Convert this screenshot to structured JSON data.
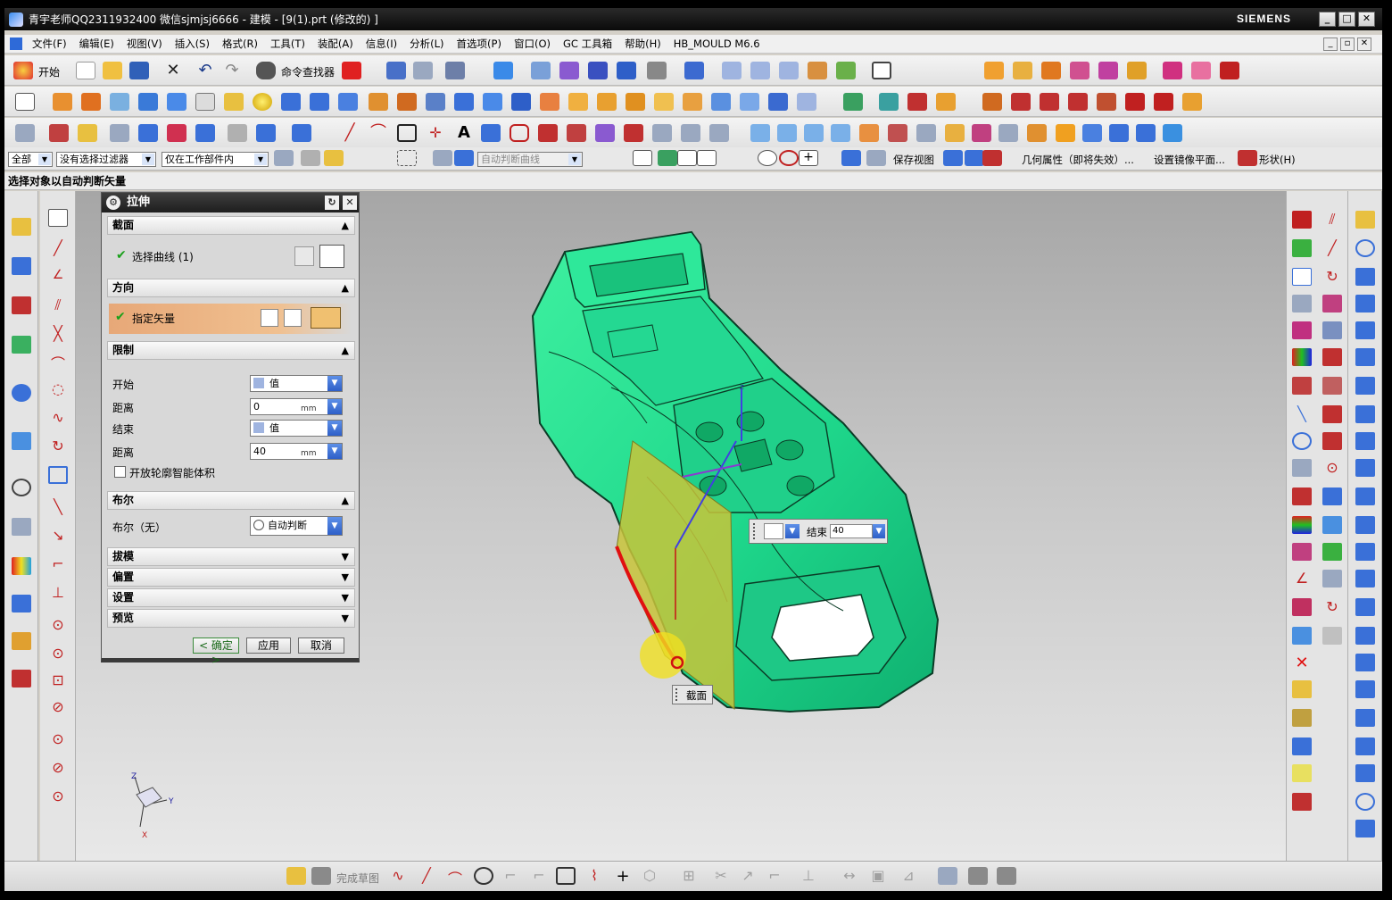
{
  "window": {
    "title": "青宇老师QQ2311932400 微信sjmjsj6666 - 建模 - [9(1).prt  (修改的) ]",
    "brand": "SIEMENS",
    "minimize": "_",
    "maximize": "□",
    "close": "✕"
  },
  "menu": {
    "items": [
      "文件(F)",
      "编辑(E)",
      "视图(V)",
      "插入(S)",
      "格式(R)",
      "工具(T)",
      "装配(A)",
      "信息(I)",
      "分析(L)",
      "首选项(P)",
      "窗口(O)",
      "GC 工具箱",
      "帮助(H)",
      "HB_MOULD M6.6"
    ]
  },
  "toolbar": {
    "start_label": "开始",
    "command_finder_label": "命令查找器"
  },
  "selection_bar": {
    "type_filter": "全部",
    "selection_filter": "没有选择过滤器",
    "scope": "仅在工作部件内",
    "curve_rule": "自动判断曲线",
    "save_view": "保存视图",
    "geometry_props": "几何属性（即将失效）...",
    "mirror_plane": "设置镜像平面...",
    "shape": "形状(H)"
  },
  "cue_line": "选择对象以自动判断矢量",
  "dialog": {
    "title": "拉伸",
    "section": {
      "header": "截面",
      "select_curve": "选择曲线 (1)"
    },
    "direction": {
      "header": "方向",
      "specify_vector": "指定矢量"
    },
    "limits": {
      "header": "限制",
      "start_label": "开始",
      "start_value": "值",
      "start_distance_label": "距离",
      "start_distance": "0",
      "end_label": "结束",
      "end_value": "值",
      "end_distance_label": "距离",
      "end_distance": "40",
      "unit": "mm",
      "open_profile": "开放轮廓智能体积"
    },
    "boolean": {
      "header": "布尔",
      "label": "布尔（无）",
      "value": "自动判断"
    },
    "collapsed": [
      "拔模",
      "偏置",
      "设置",
      "预览"
    ],
    "buttons": {
      "ok": "< 确定 >",
      "apply": "应用",
      "cancel": "取消"
    }
  },
  "viewport": {
    "end_handle_label": "结束",
    "end_handle_value": "40",
    "section_label": "截面",
    "axis_labels": {
      "x": "X",
      "y": "Y",
      "z": "Z"
    },
    "vector_label": "z"
  },
  "status_toolbar": {
    "finish_sketch": "完成草图"
  },
  "colors": {
    "model": "#1fd88c",
    "model_edge": "#0b3b26",
    "extrude_face": "#c8c43a",
    "section_curve": "#e01010",
    "title_bar": "#111111",
    "dialog_highlight": "#e7a878"
  }
}
